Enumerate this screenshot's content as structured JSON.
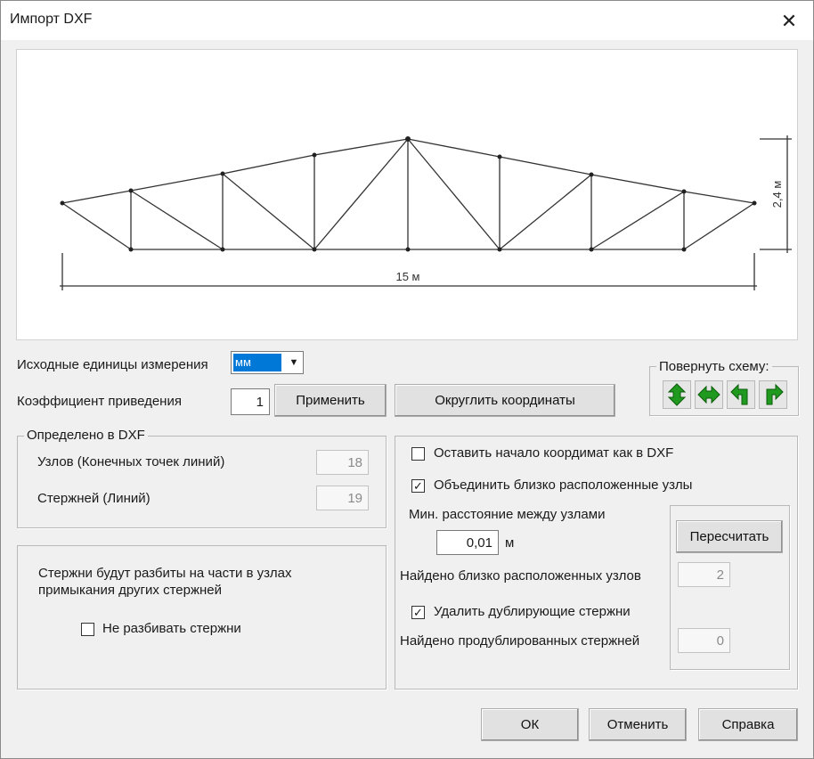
{
  "window": {
    "title": "Импорт DXF",
    "close_glyph": "✕"
  },
  "preview": {
    "dim_horizontal": "15 м",
    "dim_vertical": "2,4 м"
  },
  "units": {
    "label": "Исходные единицы измерения",
    "selected": "мм",
    "arrow": "▼"
  },
  "scale": {
    "label": "Коэффициент приведения",
    "value": "1",
    "apply_label": "Применить"
  },
  "round_button": "Округлить координаты",
  "rotate": {
    "title": "Повернуть схему:",
    "buttons": [
      "rotate-vertical-icon",
      "rotate-horizontal-icon",
      "rotate-left-icon",
      "rotate-right-icon"
    ],
    "icon_color": "#1f9a1f"
  },
  "defined": {
    "title": "Определено в DXF",
    "nodes_label": "Узлов (Конечных точек линий)",
    "nodes_value": "18",
    "bars_label": "Стержней (Линий)",
    "bars_value": "19"
  },
  "split": {
    "message": "Стержни будут разбиты на части в узлах примыкания других стержней",
    "no_split_label": "Не разбивать стержни",
    "no_split_checked": false
  },
  "options": {
    "keep_origin_label": "Оставить начало коордимат как в DXF",
    "keep_origin_checked": false,
    "merge_label": "Объединить близко расположенные узлы",
    "merge_checked": true,
    "min_dist_label": "Мин. расстояние между узлами",
    "min_dist_value": "0,01",
    "min_dist_unit": "м",
    "recalc_label": "Пересчитать",
    "found_close_label": "Найдено близко расположенных узлов",
    "found_close_value": "2",
    "remove_dup_label": "Удалить дублирующие стержни",
    "remove_dup_checked": true,
    "found_dup_label": "Найдено продублированных стержней",
    "found_dup_value": "0"
  },
  "footer": {
    "ok": "ОК",
    "cancel": "Отменить",
    "help": "Справка"
  },
  "check_glyph": "✓"
}
